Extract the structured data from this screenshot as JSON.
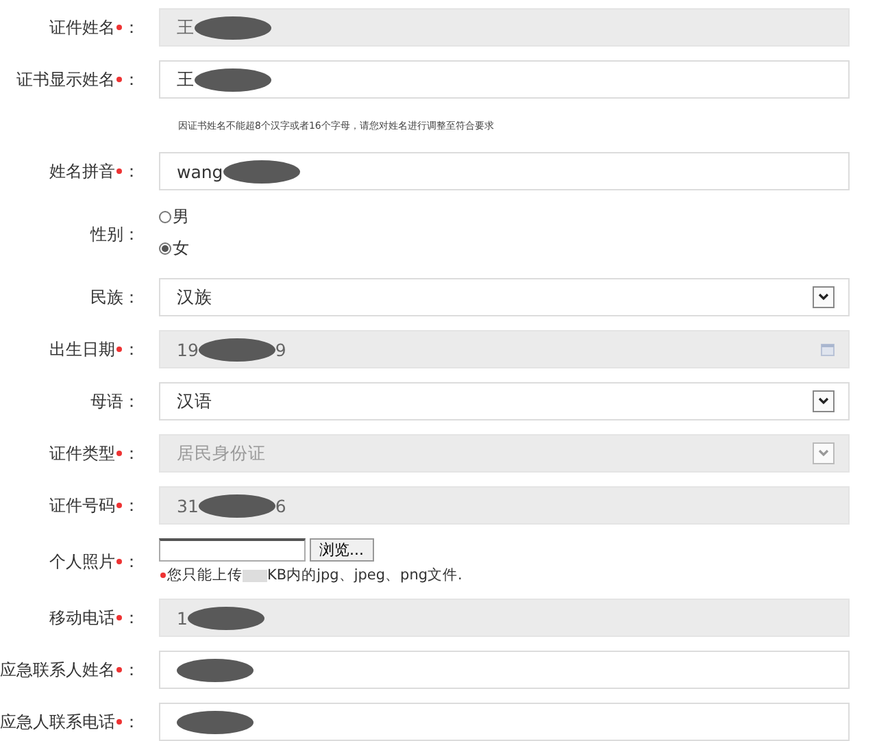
{
  "rows": [
    {
      "kind": "text",
      "label": "证件姓名：",
      "required": true,
      "disabled": true,
      "value": "王",
      "redacted": true
    },
    {
      "kind": "text",
      "label": "证书显示姓名：",
      "required": true,
      "disabled": false,
      "value": "王",
      "redacted": true
    },
    {
      "kind": "hint",
      "text": "因证书姓名不能超8个汉字或者16个字母，请您对姓名进行调整至符合要求"
    },
    {
      "kind": "text",
      "label": "姓名拼音：",
      "required": true,
      "disabled": false,
      "value": "wang",
      "redacted": true
    },
    {
      "kind": "radio",
      "label": "性别：",
      "required": false,
      "options": [
        {
          "label": "男",
          "selected": false
        },
        {
          "label": "女",
          "selected": true
        }
      ]
    },
    {
      "kind": "select",
      "label": "民族：",
      "required": false,
      "disabled": false,
      "value": "汉族"
    },
    {
      "kind": "date",
      "label": "出生日期：",
      "required": true,
      "disabled": true,
      "value": "19",
      "value_end": "9",
      "redacted": true
    },
    {
      "kind": "select",
      "label": "母语：",
      "required": false,
      "disabled": false,
      "value": "汉语"
    },
    {
      "kind": "select",
      "label": "证件类型：",
      "required": true,
      "disabled": true,
      "value": "居民身份证"
    },
    {
      "kind": "text",
      "label": "证件号码：",
      "required": true,
      "disabled": true,
      "value": "31",
      "value_end": "6",
      "redacted": true
    },
    {
      "kind": "file",
      "label": "个人照片：",
      "required": true,
      "button": "浏览...",
      "note_before": "您只能上传",
      "note_after": "KB内的jpg、jpeg、png文件."
    },
    {
      "kind": "text",
      "label": "移动电话：",
      "required": true,
      "disabled": true,
      "value": "1",
      "redacted": true
    },
    {
      "kind": "text",
      "label": "应急联系人姓名：",
      "required": true,
      "disabled": false,
      "redacted": true
    },
    {
      "kind": "text",
      "label": "应急人联系电话：",
      "required": true,
      "disabled": false,
      "redacted": true
    }
  ]
}
